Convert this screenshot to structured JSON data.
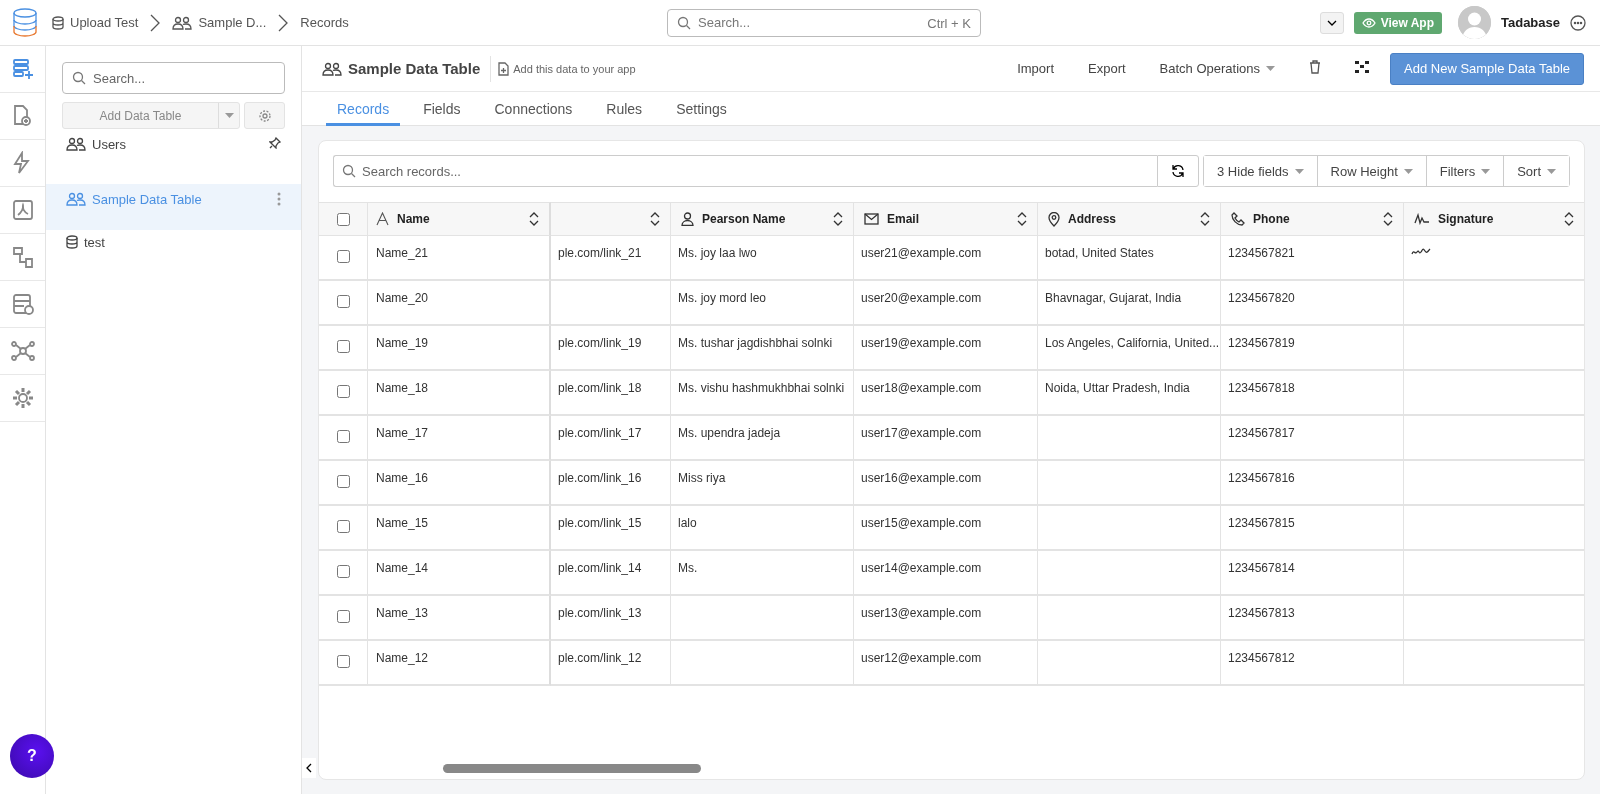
{
  "topbar": {
    "breadcrumbs": [
      {
        "label": "Upload Test",
        "kind": "database"
      },
      {
        "label": "Sample D...",
        "kind": "users"
      },
      {
        "label": "Records",
        "kind": "plain"
      }
    ],
    "search": {
      "placeholder": "Search...",
      "shortcut": "Ctrl + K"
    },
    "view_app": "View App",
    "user": "Tadabase"
  },
  "rail": [
    {
      "kind": "tables",
      "selected": true
    },
    {
      "kind": "pages",
      "selected": false
    },
    {
      "kind": "automation",
      "selected": false
    },
    {
      "kind": "pdf",
      "selected": false
    },
    {
      "kind": "pipes",
      "selected": false
    },
    {
      "kind": "data-add",
      "selected": false
    },
    {
      "kind": "network",
      "selected": false
    },
    {
      "kind": "settings",
      "selected": false
    }
  ],
  "sidebar": {
    "search": {
      "placeholder": "Search..."
    },
    "add_button": "Add Data Table",
    "tables": [
      {
        "label": "Users",
        "kind": "users",
        "selected": false,
        "pinned": true
      },
      {
        "label": "Sample Data Table",
        "kind": "users",
        "selected": true,
        "pinned": false
      },
      {
        "label": "test",
        "kind": "database",
        "selected": false,
        "pinned": false
      }
    ]
  },
  "help_button": "?",
  "header": {
    "title": "Sample Data Table",
    "add_to_app": "Add this data to your app",
    "actions": [
      "Import",
      "Export"
    ],
    "batch": "Batch Operations",
    "primary": "Add New Sample Data Table"
  },
  "tabs": [
    {
      "label": "Records",
      "selected": true
    },
    {
      "label": "Fields",
      "selected": false
    },
    {
      "label": "Connections",
      "selected": false
    },
    {
      "label": "Rules",
      "selected": false
    },
    {
      "label": "Settings",
      "selected": false
    }
  ],
  "records": {
    "search": {
      "placeholder": "Search records..."
    },
    "select_all_checked": false,
    "toolbar": [
      "3 Hide fields",
      "Row Height",
      "Filters",
      "Sort"
    ],
    "columns": [
      {
        "kind": "text",
        "label": "Name"
      },
      {
        "kind": "blank"
      },
      {
        "kind": "person",
        "label": "Pearson Name"
      },
      {
        "kind": "email",
        "label": "Email"
      },
      {
        "kind": "address",
        "label": "Address"
      },
      {
        "kind": "phone",
        "label": "Phone"
      },
      {
        "kind": "signature",
        "label": "Signature"
      }
    ],
    "rows": [
      {
        "checked": false,
        "name": "Name_21",
        "column_2": "ple.com/link_21",
        "pearson_name": "Ms. joy laa lwo",
        "email": "user21@example.com",
        "address": "botad, United States",
        "phone": "1234567821",
        "signature": true
      },
      {
        "checked": false,
        "name": "Name_20",
        "pearson_name": "Ms. joy mord leo",
        "email": "user20@example.com",
        "address": "Bhavnagar, Gujarat, India",
        "phone": "1234567820"
      },
      {
        "checked": false,
        "name": "Name_19",
        "column_2": "ple.com/link_19",
        "pearson_name": "Ms. tushar jagdishbhai solnki",
        "email": "user19@example.com",
        "address": "Los Angeles, California, United...",
        "phone": "1234567819"
      },
      {
        "checked": false,
        "name": "Name_18",
        "column_2": "ple.com/link_18",
        "pearson_name": "Ms. vishu hashmukhbhai solnki",
        "email": "user18@example.com",
        "address": "Noida, Uttar Pradesh, India",
        "phone": "1234567818"
      },
      {
        "checked": false,
        "name": "Name_17",
        "column_2": "ple.com/link_17",
        "pearson_name": "Ms. upendra jadeja",
        "email": "user17@example.com",
        "phone": "1234567817"
      },
      {
        "checked": false,
        "name": "Name_16",
        "column_2": "ple.com/link_16",
        "pearson_name": "Miss riya",
        "email": "user16@example.com",
        "phone": "1234567816"
      },
      {
        "checked": false,
        "name": "Name_15",
        "column_2": "ple.com/link_15",
        "pearson_name": "lalo",
        "email": "user15@example.com",
        "phone": "1234567815"
      },
      {
        "checked": false,
        "name": "Name_14",
        "column_2": "ple.com/link_14",
        "pearson_name": "Ms.",
        "email": "user14@example.com",
        "phone": "1234567814"
      },
      {
        "checked": false,
        "name": "Name_13",
        "column_2": "ple.com/link_13",
        "email": "user13@example.com",
        "phone": "1234567813"
      },
      {
        "checked": false,
        "name": "Name_12",
        "column_2": "ple.com/link_12",
        "email": "user12@example.com",
        "phone": "1234567812"
      }
    ]
  }
}
